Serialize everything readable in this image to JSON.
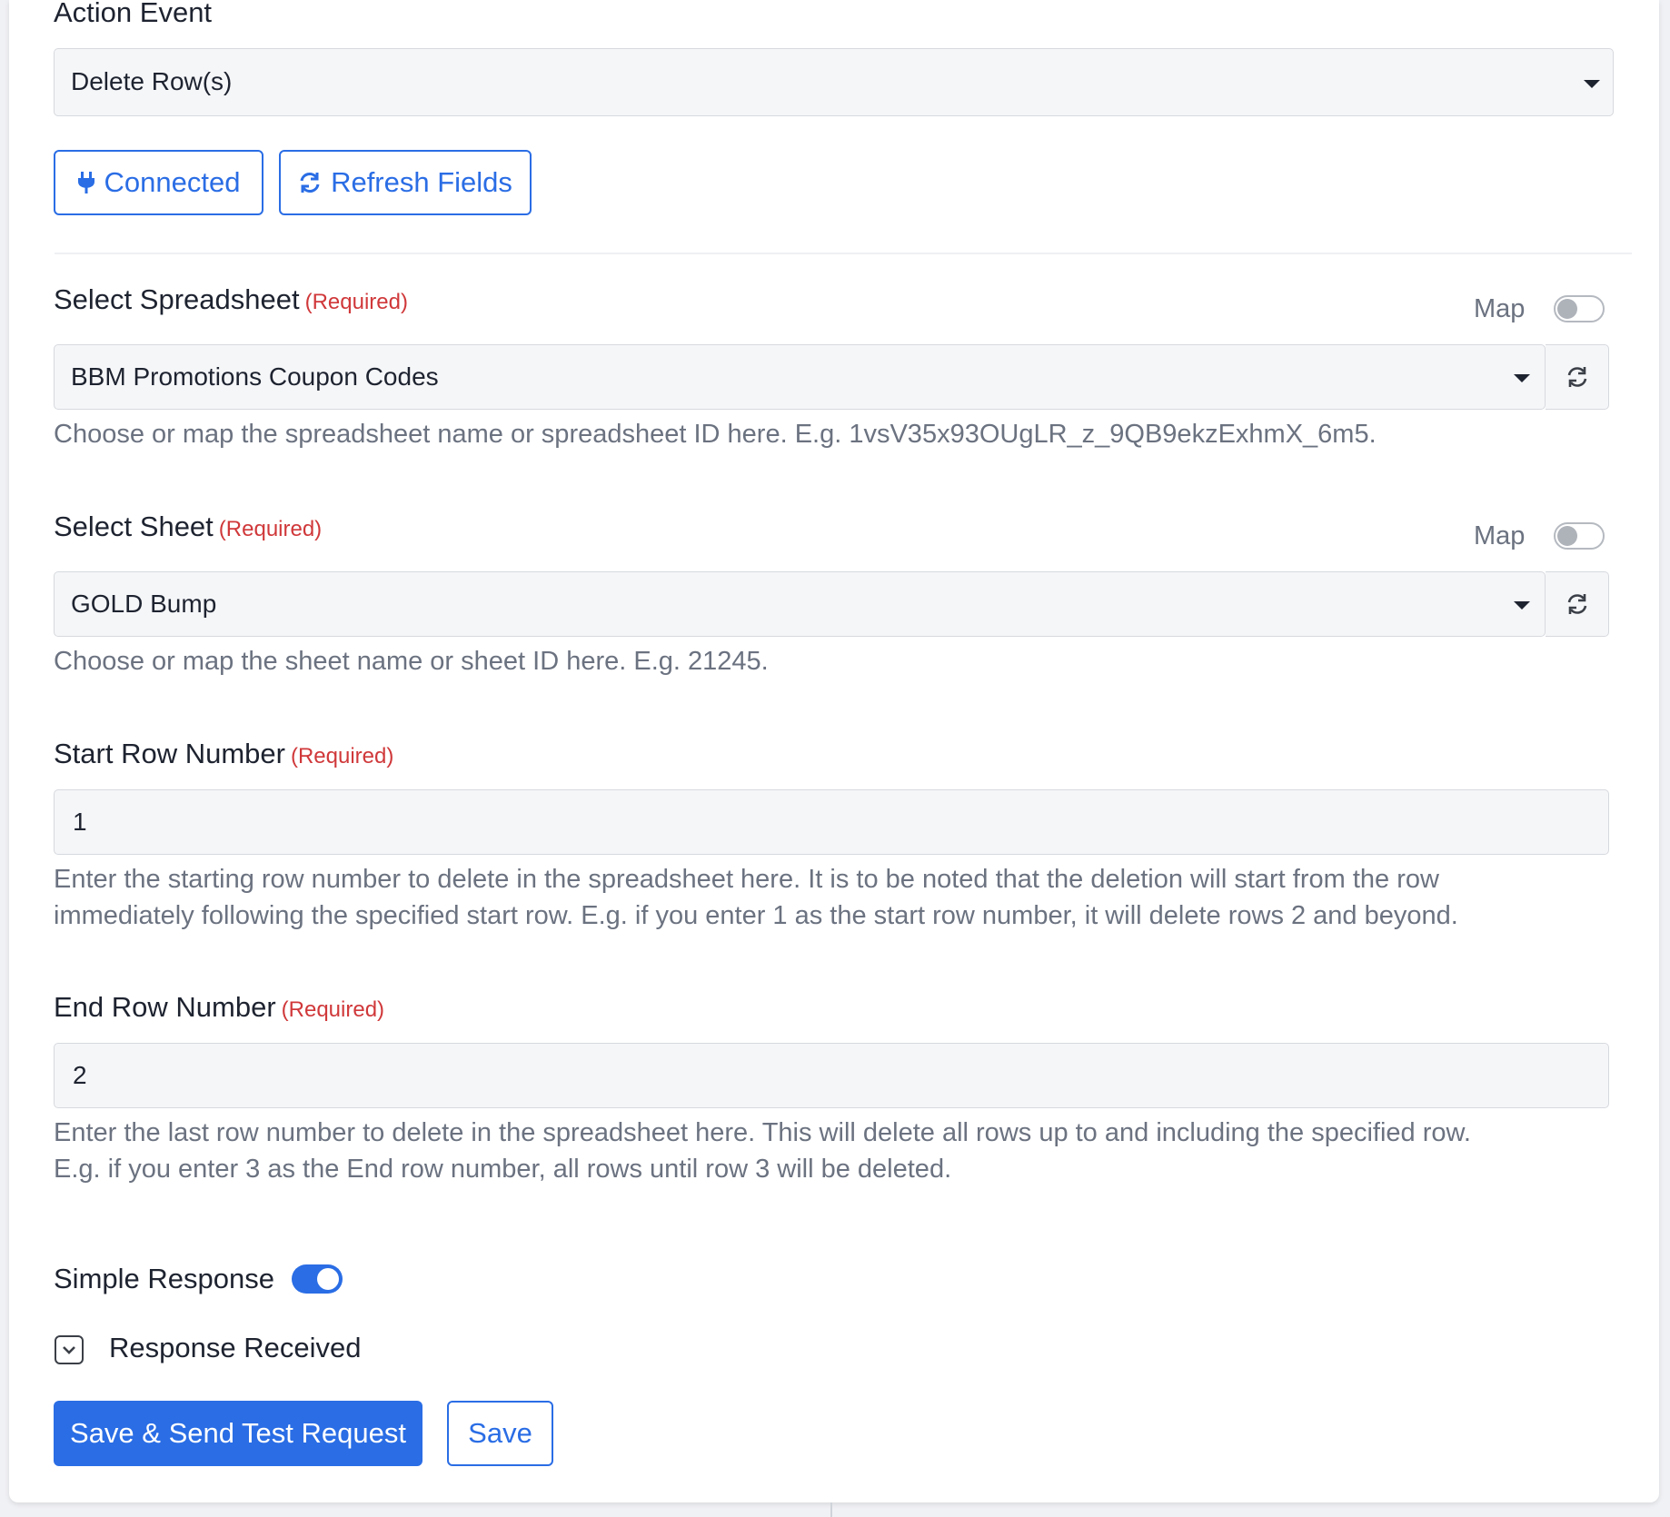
{
  "action_event": {
    "label": "Action Event",
    "value": "Delete Row(s)"
  },
  "buttons": {
    "connected": "Connected",
    "refresh_fields": "Refresh Fields",
    "save_send": "Save & Send Test Request",
    "save": "Save"
  },
  "required_text": "(Required)",
  "map_text": "Map",
  "spreadsheet": {
    "label": "Select Spreadsheet",
    "value": "BBM Promotions Coupon Codes",
    "help": "Choose or map the spreadsheet name or spreadsheet ID here. E.g. 1vsV35x93OUgLR_z_9QB9ekzExhmX_6m5."
  },
  "sheet": {
    "label": "Select Sheet",
    "value": "GOLD Bump",
    "help": "Choose or map the sheet name or sheet ID here. E.g. 21245."
  },
  "start_row": {
    "label": "Start Row Number",
    "value": "1",
    "help_line1": "Enter the starting row number to delete in the spreadsheet here. It is to be noted that the deletion will start from the row",
    "help_line2": "immediately following the specified start row. E.g. if you enter 1 as the start row number, it will delete rows 2 and beyond."
  },
  "end_row": {
    "label": "End Row Number",
    "value": "2",
    "help_line1": "Enter the last row number to delete in the spreadsheet here. This will delete all rows up to and including the specified row.",
    "help_line2": "E.g. if you enter 3 as the End row number, all rows until row 3 will be deleted."
  },
  "simple_response": {
    "label": "Simple Response",
    "enabled": true
  },
  "response_received": {
    "label": "Response Received"
  },
  "colors": {
    "accent": "#2a6de5",
    "required": "#d0383a",
    "help_text": "#6b7280"
  }
}
